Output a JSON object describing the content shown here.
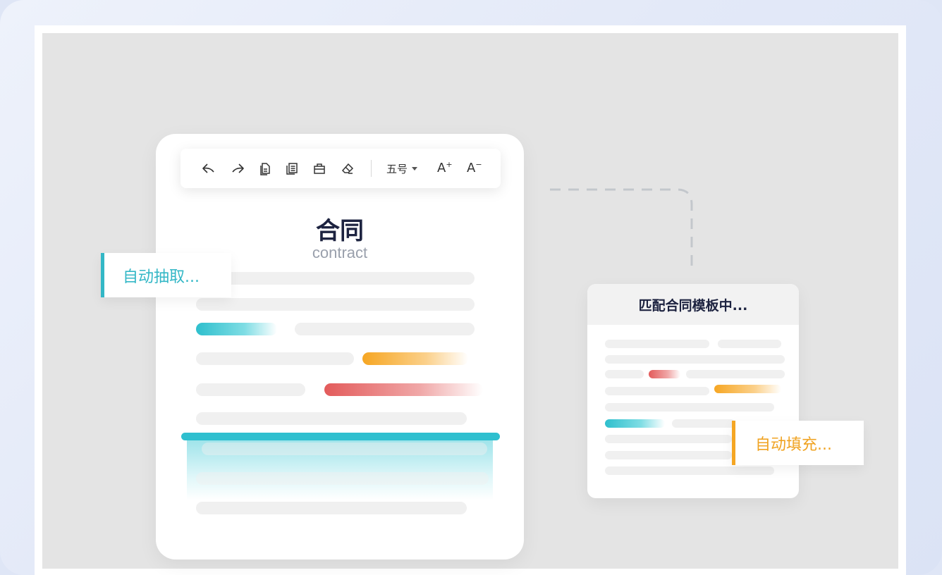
{
  "toolbar": {
    "icons": [
      "undo-icon",
      "redo-icon",
      "paste-document-icon",
      "copy-document-icon",
      "briefcase-icon",
      "eraser-icon"
    ],
    "font_size_value": "五号",
    "increase_font_label": "A",
    "decrease_font_label": "A"
  },
  "document": {
    "title": "合同",
    "subtitle": "contract"
  },
  "tags": {
    "extract": "自动抽取...",
    "fill": "自动填充..."
  },
  "match_card": {
    "header": "匹配合同模板中..."
  },
  "colors": {
    "teal": "#33b7c6",
    "orange": "#f5a623",
    "red": "#e35b5b",
    "title_dark": "#1d2340",
    "canvas_gray": "#e4e4e4"
  }
}
